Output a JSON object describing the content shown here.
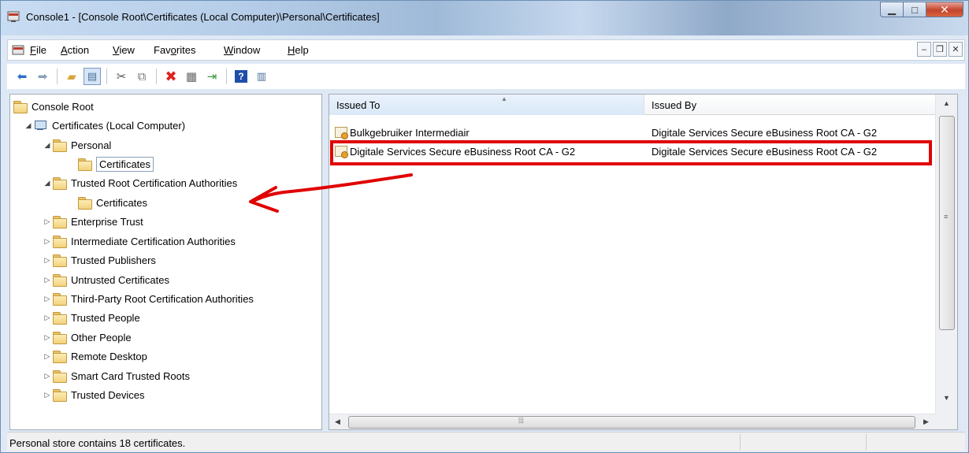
{
  "window": {
    "title": "Console1 - [Console Root\\Certificates (Local Computer)\\Personal\\Certificates]"
  },
  "menu": {
    "items": [
      {
        "pre": "",
        "key": "F",
        "post": "ile"
      },
      {
        "pre": "",
        "key": "A",
        "post": "ction"
      },
      {
        "pre": "",
        "key": "V",
        "post": "iew"
      },
      {
        "pre": "Fav",
        "key": "o",
        "post": "rites"
      },
      {
        "pre": "",
        "key": "W",
        "post": "indow"
      },
      {
        "pre": "",
        "key": "H",
        "post": "elp"
      }
    ]
  },
  "toolbar": {
    "icons": [
      "back-icon",
      "forward-icon",
      "up-folder-icon",
      "show-hide-console-tree-icon",
      "cut-icon",
      "copy-icon",
      "delete-icon",
      "properties-icon",
      "export-list-icon",
      "help-icon",
      "show-hide-action-pane-icon"
    ]
  },
  "tree": {
    "items": [
      {
        "label": "Console Root",
        "expander": ""
      },
      {
        "label": "Certificates (Local Computer)",
        "expander": "◢"
      },
      {
        "label": "Personal",
        "expander": "◢"
      },
      {
        "label": "Certificates",
        "expander": ""
      },
      {
        "label": "Trusted Root Certification Authorities",
        "expander": "◢"
      },
      {
        "label": "Certificates",
        "expander": ""
      },
      {
        "label": "Enterprise Trust",
        "expander": "▷"
      },
      {
        "label": "Intermediate Certification Authorities",
        "expander": "▷"
      },
      {
        "label": "Trusted Publishers",
        "expander": "▷"
      },
      {
        "label": "Untrusted Certificates",
        "expander": "▷"
      },
      {
        "label": "Third-Party Root Certification Authorities",
        "expander": "▷"
      },
      {
        "label": "Trusted People",
        "expander": "▷"
      },
      {
        "label": "Other People",
        "expander": "▷"
      },
      {
        "label": "Remote Desktop",
        "expander": "▷"
      },
      {
        "label": "Smart Card Trusted Roots",
        "expander": "▷"
      },
      {
        "label": "Trusted Devices",
        "expander": "▷"
      }
    ]
  },
  "list": {
    "columns": [
      "Issued To",
      "Issued By"
    ],
    "rows": [
      {
        "issued_to": "Bulkgebruiker Intermediair",
        "issued_by": "Digitale Services Secure eBusiness Root CA - G2"
      },
      {
        "issued_to": "Digitale Services Secure eBusiness Root CA - G2",
        "issued_by": "Digitale Services Secure eBusiness Root CA - G2"
      }
    ],
    "scroll_left_glyph": "◀",
    "scroll_right_glyph": "▶",
    "scroll_up_glyph": "▲",
    "scroll_down_glyph": "▼"
  },
  "status": {
    "text": "Personal store contains 18 certificates."
  },
  "colors": {
    "annotation": "#e00000",
    "selection_border": "#8aa0bb"
  }
}
